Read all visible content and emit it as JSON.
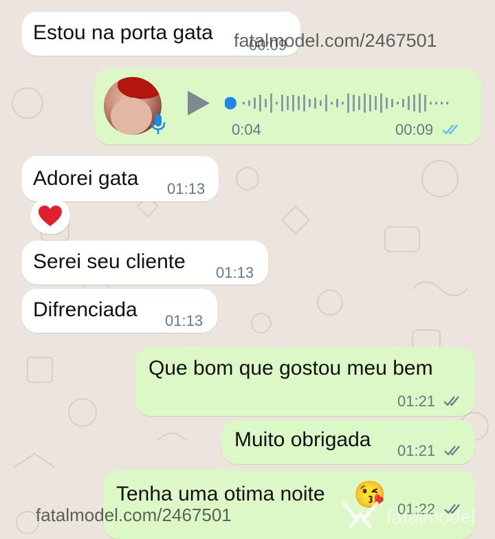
{
  "messages": [
    {
      "text": "Estou na porta gata",
      "time": "00:09"
    },
    {
      "type": "voice",
      "position": "0:04",
      "time": "00:09",
      "progress": 0.0,
      "status": "read"
    },
    {
      "text": "Adorei gata",
      "time": "01:13"
    },
    {
      "reaction": "heart"
    },
    {
      "text": "Serei seu cliente",
      "time": "01:13"
    },
    {
      "text": "Difrenciada",
      "time": "01:13"
    },
    {
      "text": "Que bom que gostou meu bem",
      "time": "01:21",
      "status": "read"
    },
    {
      "text": "Muito obrigada",
      "time": "01:21",
      "status": "read"
    },
    {
      "text": "Tenha uma otima noite",
      "emoji": "😘",
      "time": "01:22",
      "status": "read"
    }
  ],
  "watermarks": {
    "top": "fatalmodel.com/2467501",
    "bottom": "fatalmodel.com/2467501",
    "brand": "fatalmodel"
  },
  "colors": {
    "incoming": "#ffffff",
    "outgoing": "#dcf8c6",
    "ticks": "#53bdeb",
    "ticks_grey": "#667781",
    "voice_dot": "#1e88e5",
    "mic": "#1e88e5"
  },
  "icons": [
    "play-icon",
    "mic-icon",
    "double-check-icon",
    "heart-icon",
    "wink-kiss-emoji"
  ]
}
